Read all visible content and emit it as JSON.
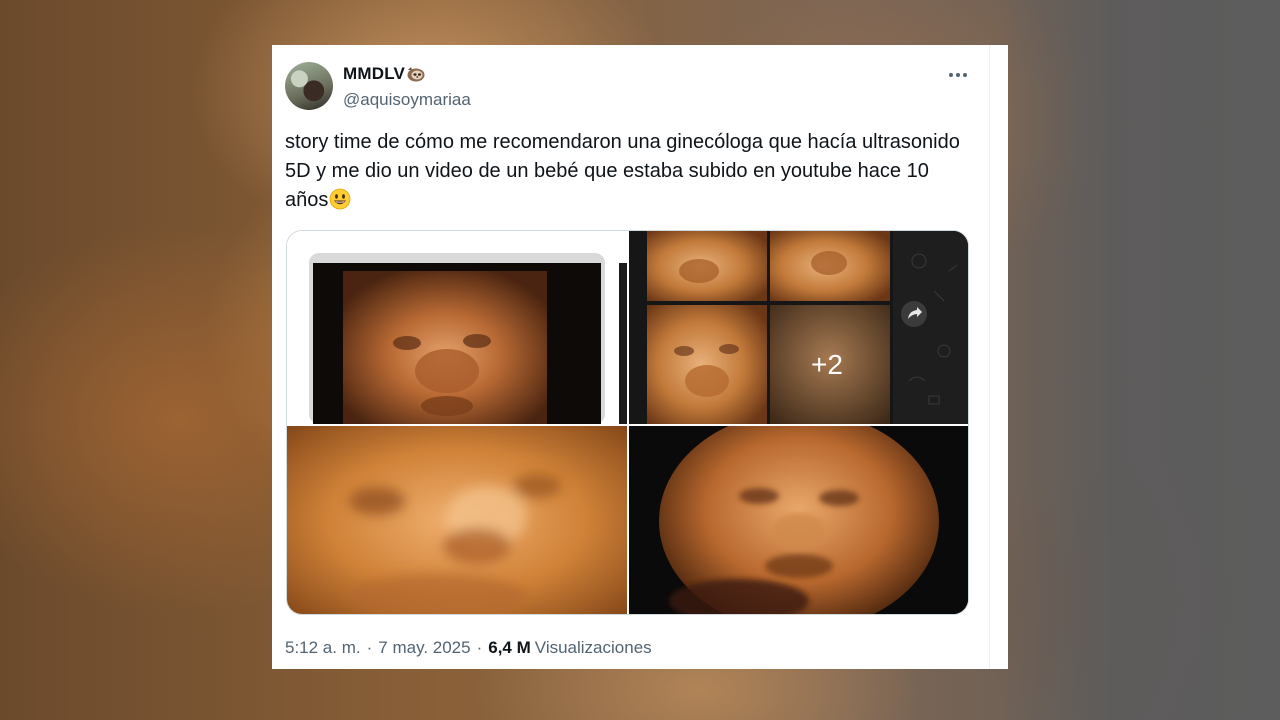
{
  "tweet": {
    "display_name": "MMDLV",
    "display_name_emoji": "sloth-emoji",
    "handle": "@aquisoymariaa",
    "text": "story time de cómo me recomendaron una ginecóloga que hacía ultrasonido 5D y me dio un video de un bebé que estaba subido en youtube hace 10 años",
    "text_emoji": "smiley-emoji",
    "time": "5:12 a. m.",
    "separator": "·",
    "date": "7 may. 2025",
    "views_count": "6,4 M",
    "views_label": "Visualizaciones"
  },
  "media": {
    "images": [
      {
        "name": "ultrasound-screenshot-1"
      },
      {
        "name": "ultrasound-collage-whatsapp",
        "more_count_label": "+2",
        "icon": "forward-share-icon"
      },
      {
        "name": "ultrasound-closeup-blurry"
      },
      {
        "name": "ultrasound-face-dark"
      }
    ]
  },
  "icons": {
    "more": "more-horizontal-icon"
  },
  "colors": {
    "text_primary": "#0f1419",
    "text_secondary": "#536471",
    "border": "#cfd9de",
    "ultrasound_orange": "#c8782c"
  }
}
